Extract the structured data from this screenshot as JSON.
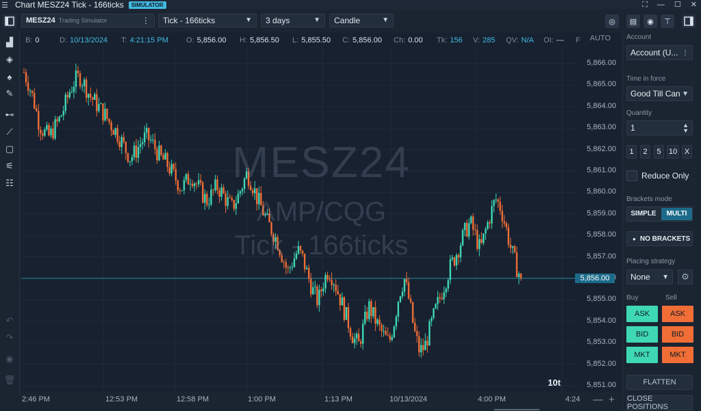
{
  "window": {
    "title": "Chart MESZ24 Tick - 166ticks",
    "badge": "SIMULATOR"
  },
  "toolbar": {
    "symbol": "MESZ24",
    "account_sub": "Trading Simulator",
    "chart_type_value": "Tick - 166ticks",
    "period_value": "3 days",
    "style_value": "Candle"
  },
  "infobar": [
    {
      "key": "B:",
      "value": "0",
      "accent": false
    },
    {
      "key": "D:",
      "value": "10/13/2024",
      "accent": true
    },
    {
      "key": "T:",
      "value": "4:21:15 PM",
      "accent": true
    },
    {
      "key": "O:",
      "value": "5,856.00",
      "accent": false
    },
    {
      "key": "H:",
      "value": "5,856.50",
      "accent": false
    },
    {
      "key": "L:",
      "value": "5,855.50",
      "accent": false
    },
    {
      "key": "C:",
      "value": "5,856.00",
      "accent": false
    },
    {
      "key": "Ch:",
      "value": "0.00",
      "accent": false
    },
    {
      "key": "Tk:",
      "value": "156",
      "accent": true
    },
    {
      "key": "V:",
      "value": "285",
      "accent": true
    },
    {
      "key": "QV:",
      "value": "N/A",
      "accent": true
    },
    {
      "key": "OI:",
      "value": "---",
      "accent": false
    },
    {
      "key": "F",
      "value": "",
      "accent": false
    }
  ],
  "chart_controls": {
    "auto_label": "AUTO",
    "tick_counter": "10t",
    "current_price": "5,856.00"
  },
  "watermark": {
    "line1": "MESZ24",
    "line2": "AMP/CQG",
    "line3": "Tick - 166ticks"
  },
  "chart_data": {
    "type": "candlestick",
    "y_axis_ticks": [
      "5,866.00",
      "5,865.00",
      "5,864.00",
      "5,863.00",
      "5,862.00",
      "5,861.00",
      "5,860.00",
      "5,859.00",
      "5,858.00",
      "5,857.00",
      "5,856.00",
      "5,855.00",
      "5,854.00",
      "5,853.00",
      "5,852.00",
      "5,851.00"
    ],
    "ylim": [
      5851,
      5866
    ],
    "x_axis_labels": [
      "2:46 PM",
      "12:53 PM",
      "12:58 PM",
      "1:00 PM",
      "1:13 PM",
      "10/13/2024",
      "4:00 PM",
      "4:24"
    ],
    "last_price": 5856.0,
    "close_path": [
      5865.6,
      5865.0,
      5864.2,
      5863.2,
      5862.8,
      5862.6,
      5863.0,
      5863.4,
      5864.0,
      5864.7,
      5865.2,
      5865.4,
      5865.0,
      5864.5,
      5864.2,
      5863.9,
      5863.6,
      5863.2,
      5862.9,
      5862.5,
      5862.0,
      5861.6,
      5861.9,
      5862.3,
      5862.6,
      5862.4,
      5862.0,
      5861.6,
      5861.4,
      5861.0,
      5860.6,
      5860.2,
      5860.5,
      5860.8,
      5860.4,
      5860.0,
      5859.6,
      5859.9,
      5860.3,
      5860.0,
      5859.6,
      5859.3,
      5859.7,
      5860.3,
      5860.9,
      5860.4,
      5859.7,
      5859.2,
      5858.6,
      5858.2,
      5857.7,
      5857.0,
      5856.3,
      5856.8,
      5857.3,
      5856.9,
      5856.1,
      5855.4,
      5854.9,
      5855.8,
      5856.4,
      5856.0,
      5855.3,
      5854.6,
      5853.9,
      5853.2,
      5852.9,
      5853.8,
      5854.7,
      5854.2,
      5853.7,
      5853.3,
      5853.0,
      5854.0,
      5855.3,
      5856.0,
      5854.9,
      5853.5,
      5852.6,
      5852.8,
      5853.6,
      5854.4,
      5855.1,
      5855.8,
      5856.5,
      5857.0,
      5857.6,
      5858.2,
      5858.6,
      5858.0,
      5857.3,
      5858.2,
      5859.0,
      5859.7,
      5859.3,
      5858.4,
      5857.4,
      5856.6,
      5856.0
    ]
  },
  "right_panel": {
    "account_label": "Account",
    "account_value": "Account (U...",
    "tif_label": "Time in force",
    "tif_value": "Good Till Can",
    "qty_label": "Quantity",
    "qty_value": "1",
    "quick_qty": [
      "1",
      "2",
      "5",
      "10",
      "X"
    ],
    "reduce_only": "Reduce Only",
    "brackets_label": "Brackets mode",
    "bracket_simple": "SIMPLE",
    "bracket_multi": "MULTI",
    "no_brackets": "NO BRACKETS S",
    "strategy_label": "Placing strategy",
    "strategy_value": "None",
    "buy_label": "Buy",
    "sell_label": "Sell",
    "buy_buttons": [
      "ASK",
      "BID",
      "MKT"
    ],
    "sell_buttons": [
      "ASK",
      "BID",
      "MKT"
    ],
    "flatten": "FLATTEN",
    "close_positions": "CLOSE POSITIONS"
  },
  "colors": {
    "up": "#3fd8b5",
    "down": "#f06e36",
    "price_line": "#2a8aa6",
    "accent": "#43b9e1"
  }
}
